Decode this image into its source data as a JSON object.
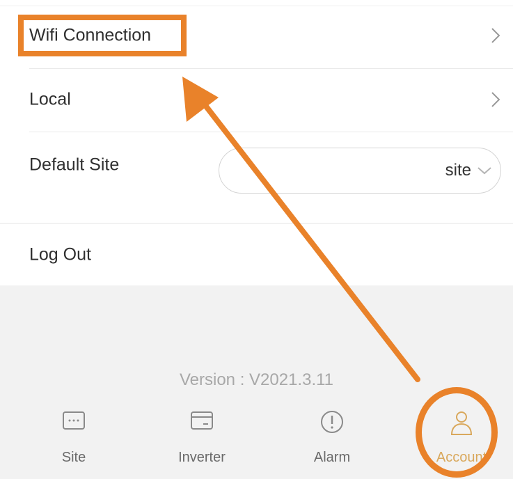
{
  "settings": {
    "wifi_label": "Wifi Connection",
    "local_label": "Local",
    "default_site_label": "Default Site",
    "default_site_value": "site",
    "logout_label": "Log Out"
  },
  "footer": {
    "version": "Version : V2021.3.11"
  },
  "nav": {
    "site": "Site",
    "inverter": "Inverter",
    "alarm": "Alarm",
    "account": "Account"
  },
  "colors": {
    "annotation": "#e9822a",
    "account_active": "#d9a85c"
  },
  "icons": [
    "chevron-right-icon",
    "chevron-down-icon",
    "site-icon",
    "inverter-icon",
    "alarm-icon",
    "account-icon"
  ]
}
